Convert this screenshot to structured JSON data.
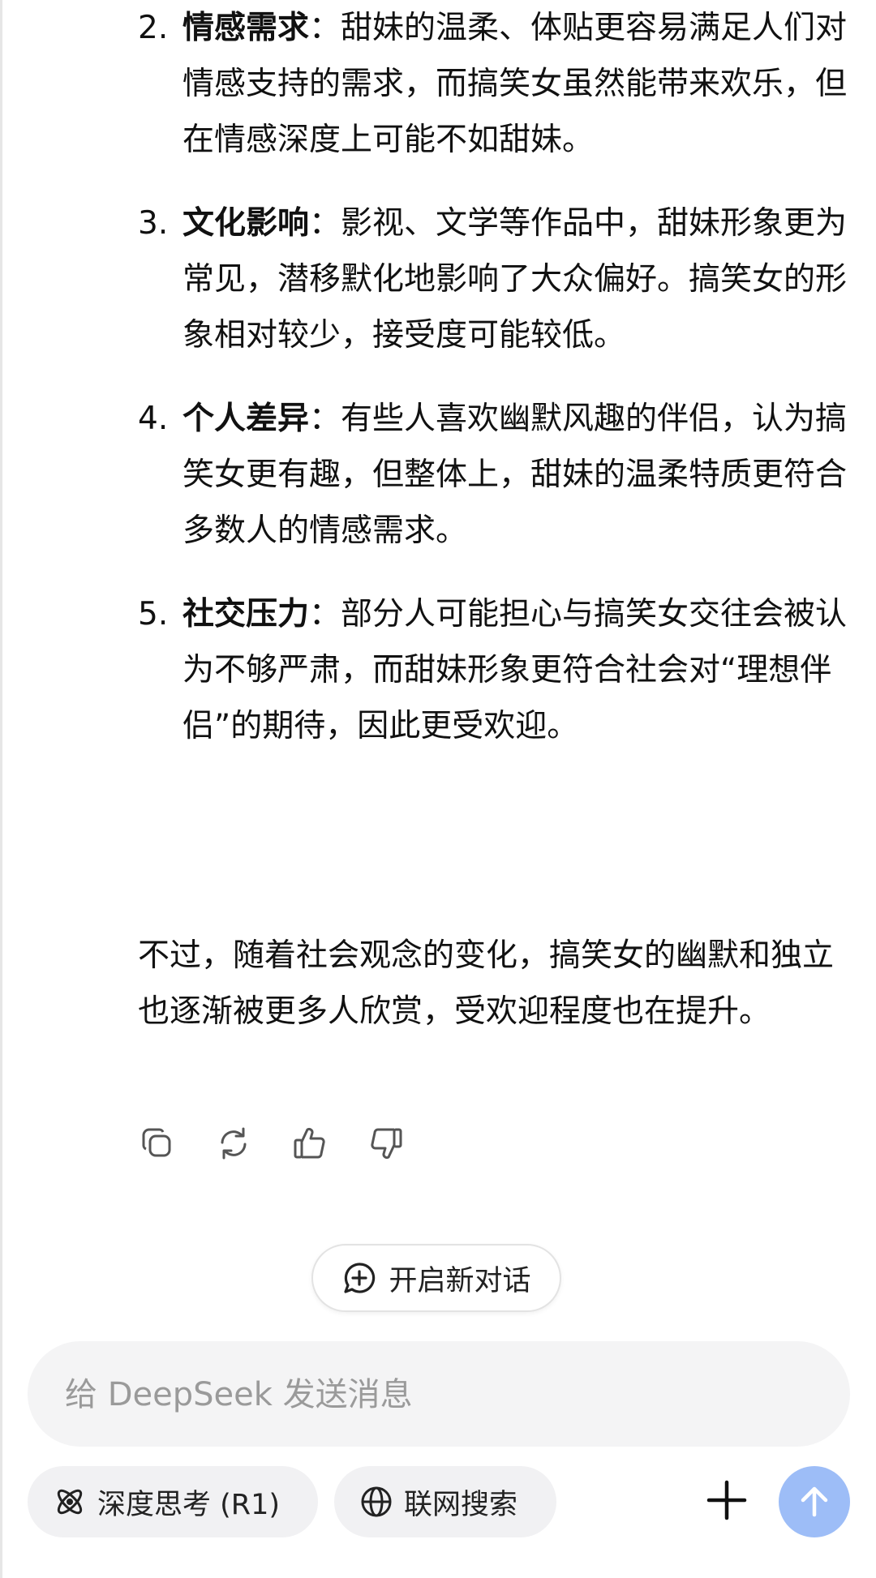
{
  "list": [
    {
      "num": "2.",
      "term": "情感需求",
      "sep": "：",
      "text": "甜妹的温柔、体贴更容易满足人们对情感支持的需求，而搞笑女虽然能带来欢乐，但在情感深度上可能不如甜妹。"
    },
    {
      "num": "3.",
      "term": "文化影响",
      "sep": "：",
      "text": "影视、文学等作品中，甜妹形象更为常见，潜移默化地影响了大众偏好。搞笑女的形象相对较少，接受度可能较低。"
    },
    {
      "num": "4.",
      "term": "个人差异",
      "sep": "：",
      "text": "有些人喜欢幽默风趣的伴侣，认为搞笑女更有趣，但整体上，甜妹的温柔特质更符合多数人的情感需求。"
    },
    {
      "num": "5.",
      "term": "社交压力",
      "sep": "：",
      "text": "部分人可能担心与搞笑女交往会被认为不够严肃，而甜妹形象更符合社会对“理想伴侣”的期待，因此更受欢迎。"
    }
  ],
  "conclusion": "不过，随着社会观念的变化，搞笑女的幽默和独立也逐渐被更多人欣赏，受欢迎程度也在提升。",
  "actions": {
    "icons": [
      "copy-icon",
      "regenerate-icon",
      "thumbs-up-icon",
      "thumbs-down-icon"
    ]
  },
  "new_chat": {
    "label": "开启新对话",
    "icon": "chat-plus-icon"
  },
  "composer": {
    "placeholder": "给 DeepSeek 发送消息"
  },
  "toolbar": {
    "deep_think_label": "深度思考 (R1)",
    "web_search_label": "联网搜索",
    "plus_icon": "plus-icon",
    "send_icon": "arrow-up-icon"
  },
  "colors": {
    "send_button": "#9dbdf7",
    "chip_bg": "#f1f1f3",
    "composer_bg": "#f4f4f5"
  }
}
